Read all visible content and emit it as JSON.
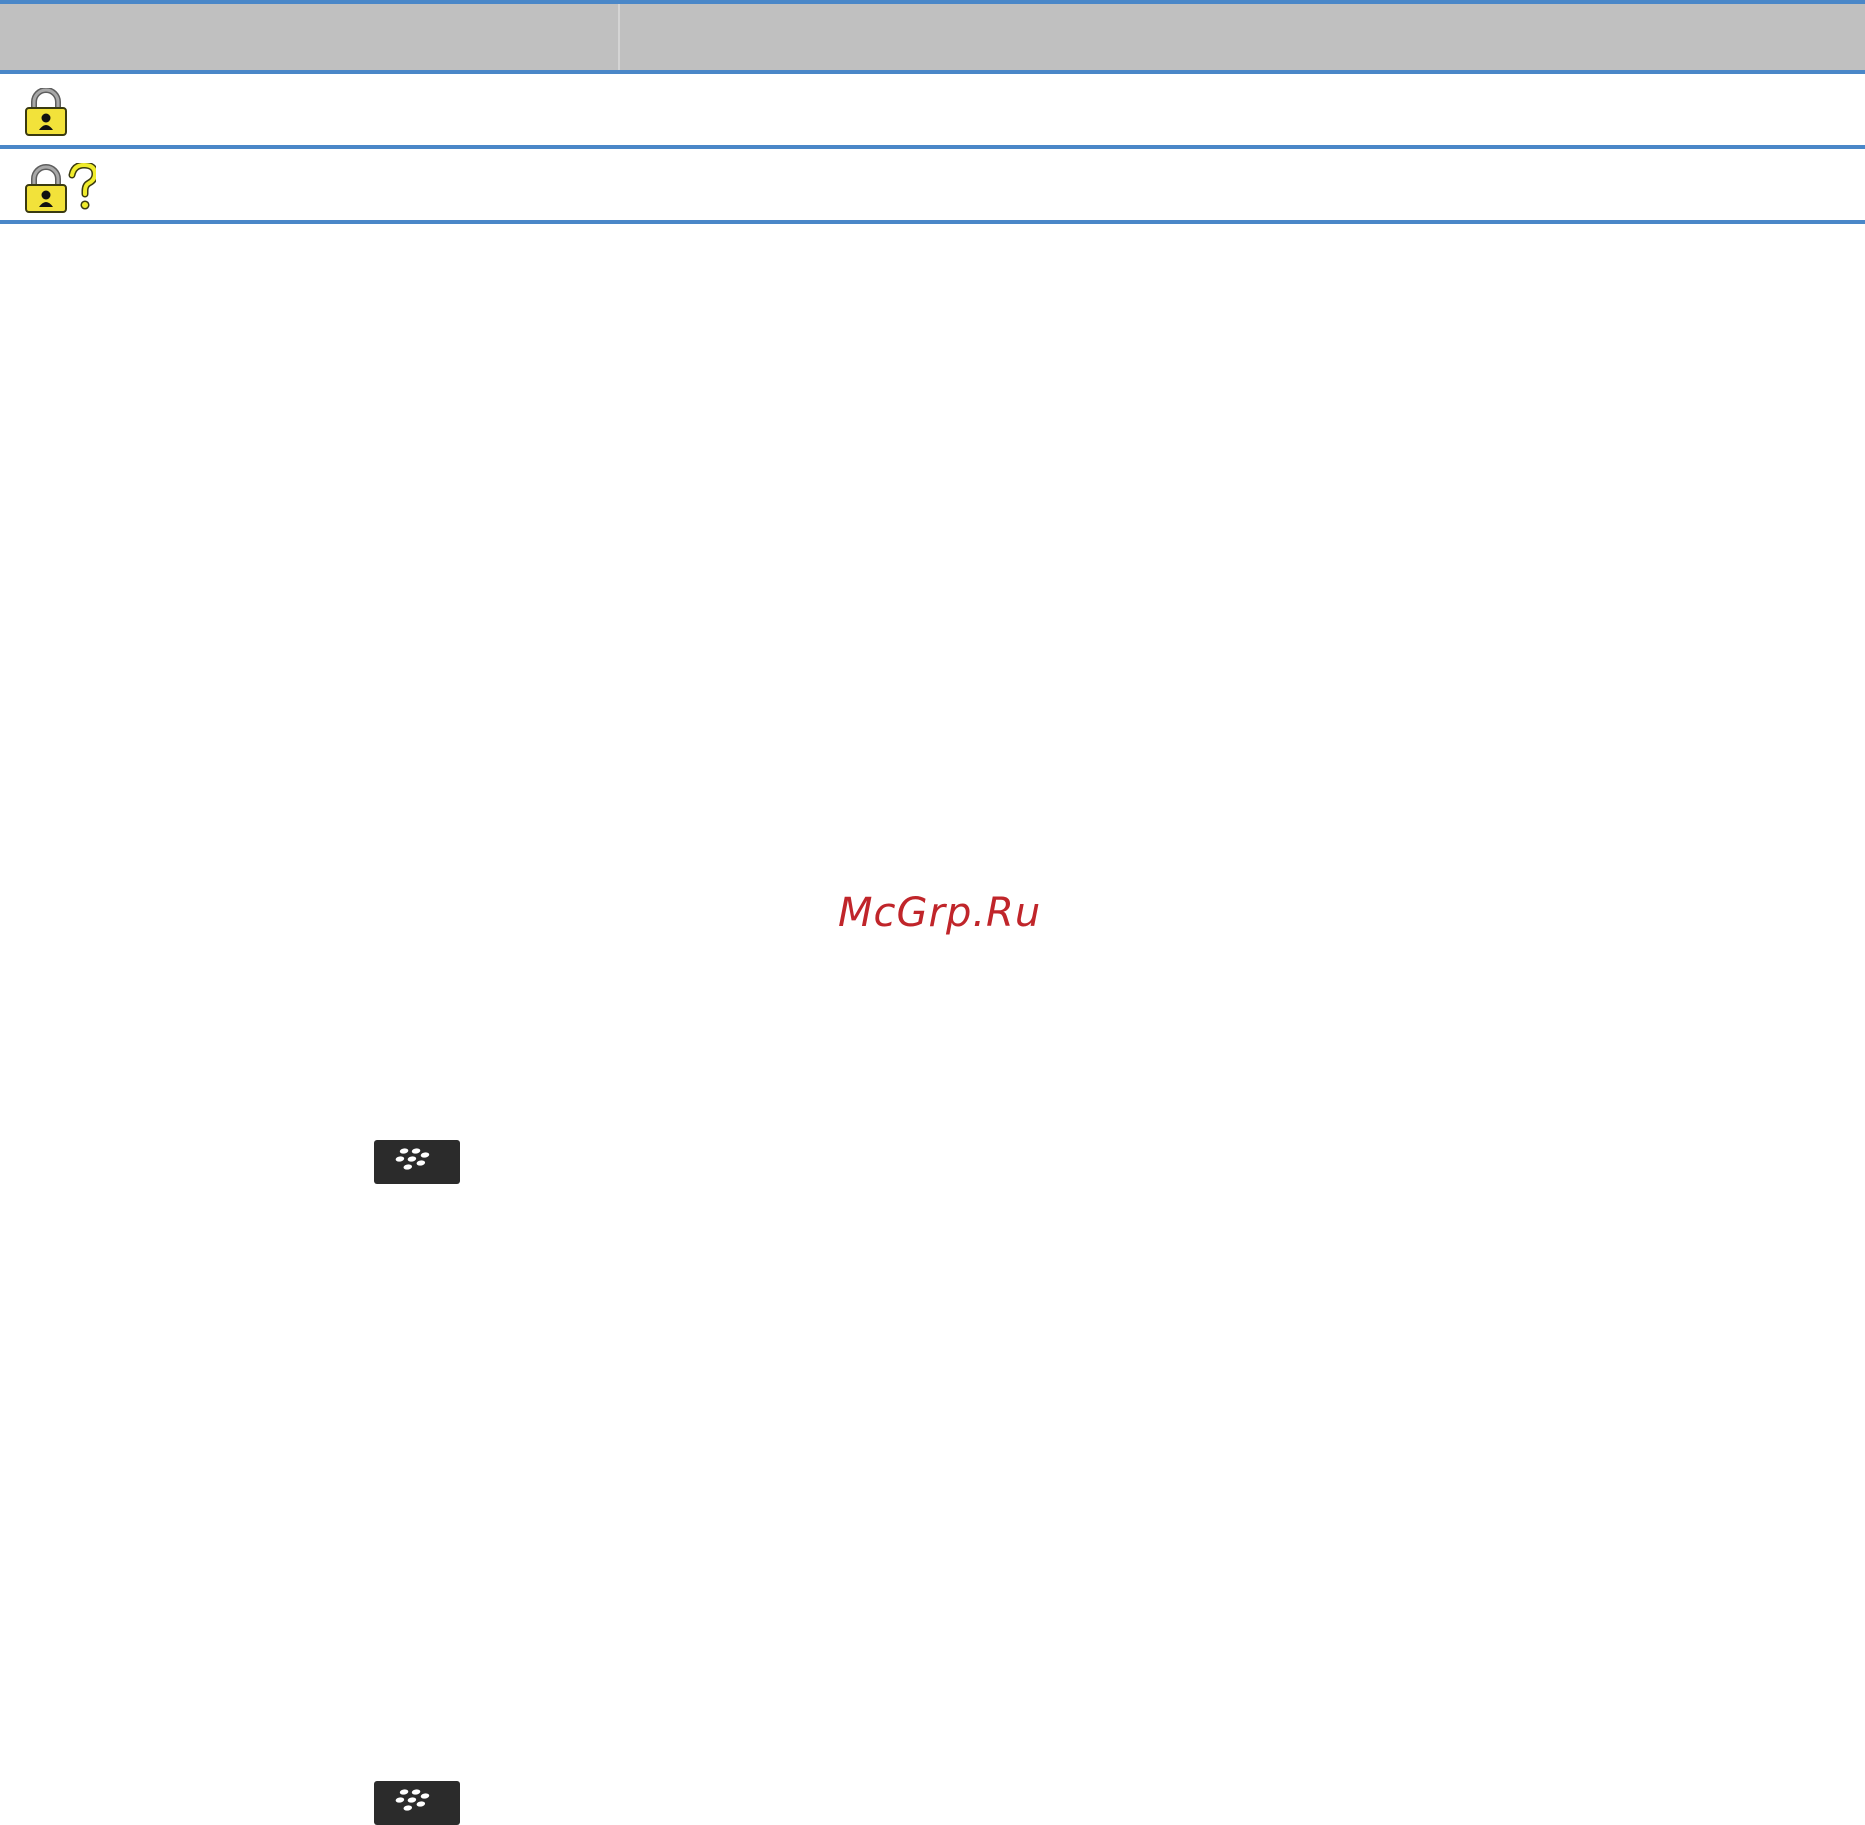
{
  "table": {
    "header": {
      "col1": "",
      "col2": ""
    },
    "rows": [
      {
        "icon": "padlock-icon",
        "description": ""
      },
      {
        "icon": "padlock-question-icon",
        "description": ""
      }
    ]
  },
  "watermark": {
    "text": "McGrp.Ru"
  },
  "keys": [
    {
      "icon": "blackberry-menu-key-icon"
    },
    {
      "icon": "blackberry-menu-key-icon"
    }
  ],
  "colors": {
    "rule": "#4a87c8",
    "header_bg": "#c0c0c0",
    "lock_body": "#f2e23a",
    "lock_shackle": "#8e8e8e",
    "question_mark": "#f0ec2c",
    "watermark": "#c0252a",
    "key_bg": "#2b2b2b"
  }
}
